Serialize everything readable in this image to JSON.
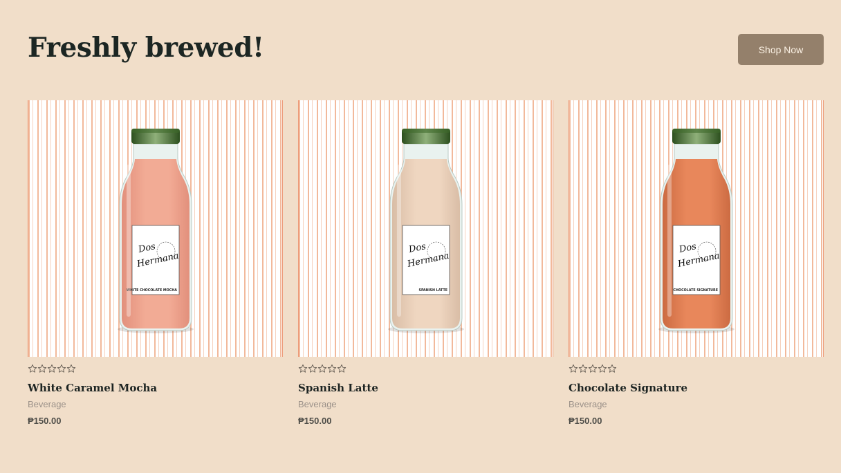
{
  "header": {
    "title": "Freshly brewed!",
    "cta_label": "Shop Now"
  },
  "products": [
    {
      "name": "White Caramel Mocha",
      "category": "Beverage",
      "price": "₱150.00",
      "rating": 0,
      "label_brand_line1": "Dos",
      "label_brand_line2": "Hermana",
      "label_flavor": "WHITE CHOCOLATE MOCHA",
      "liquid_color": "#f2ab95",
      "liquid_shade": "#e2907c"
    },
    {
      "name": "Spanish Latte",
      "category": "Beverage",
      "price": "₱150.00",
      "rating": 0,
      "label_brand_line1": "Dos",
      "label_brand_line2": "Hermana",
      "label_flavor": "SPANISH LATTE",
      "liquid_color": "#efd6c0",
      "liquid_shade": "#d9bda6"
    },
    {
      "name": "Chocolate Signature",
      "category": "Beverage",
      "price": "₱150.00",
      "rating": 0,
      "label_brand_line1": "Dos",
      "label_brand_line2": "Hermana",
      "label_flavor": "CHOCOLATE SIGNATURE",
      "liquid_color": "#e8875b",
      "liquid_shade": "#cc6b42"
    }
  ],
  "colors": {
    "background": "#f1dec9",
    "button": "#94806b",
    "heading": "#1c2623",
    "cap": "#3f6b2b"
  }
}
